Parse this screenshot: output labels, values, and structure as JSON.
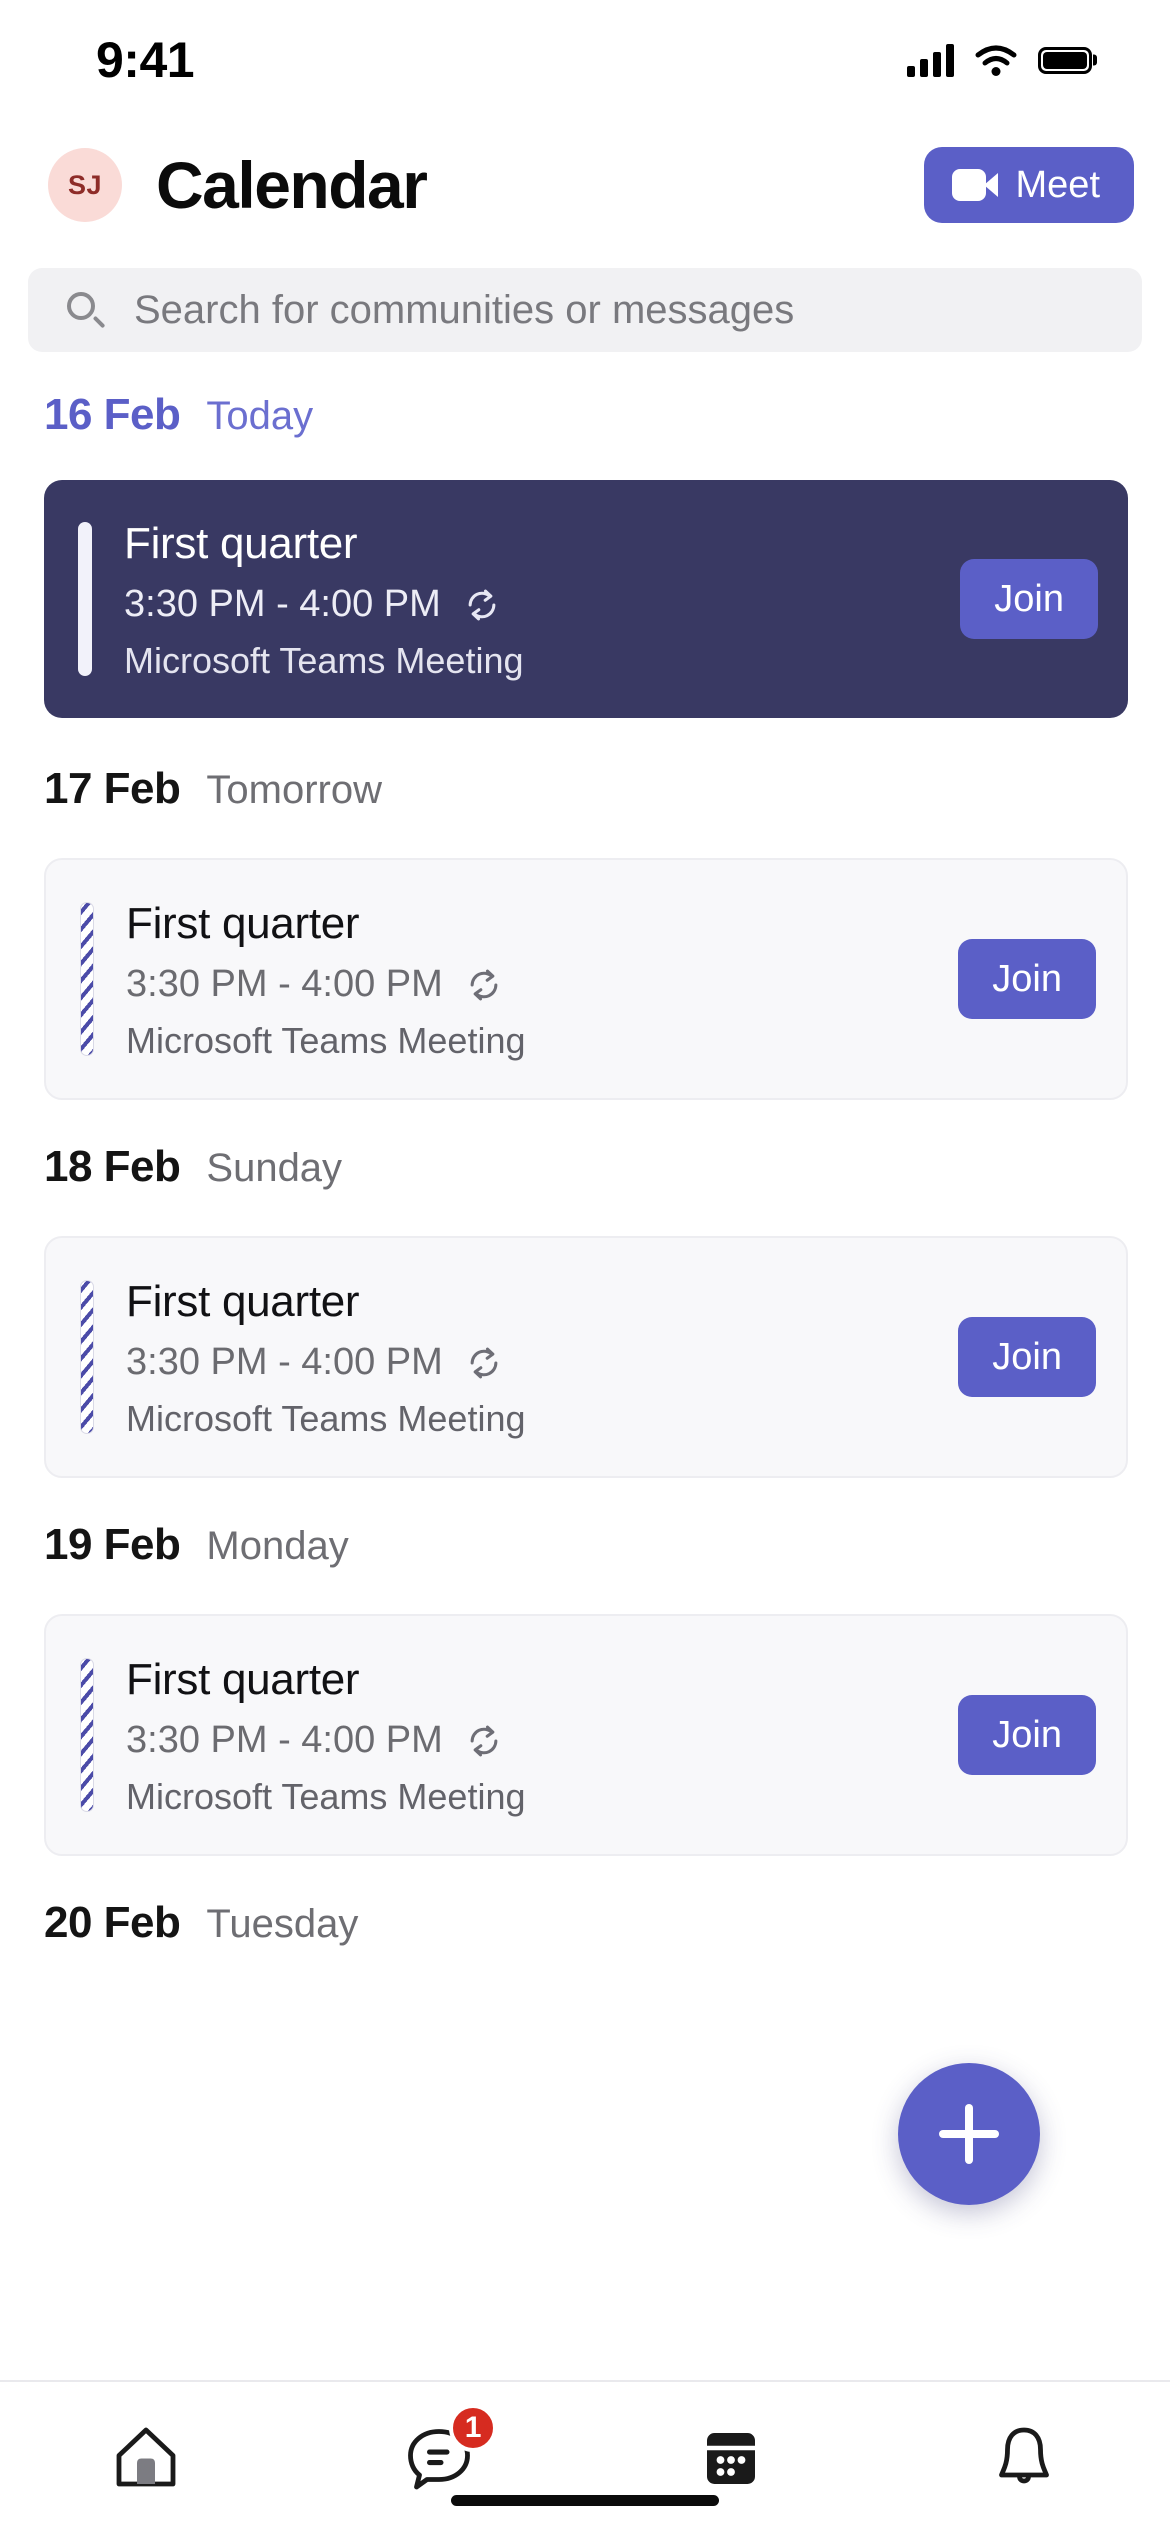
{
  "status_bar": {
    "time": "9:41",
    "signal_icon": "cellular-signal-icon",
    "wifi_icon": "wifi-icon",
    "battery_icon": "battery-icon"
  },
  "header": {
    "avatar_initials": "SJ",
    "avatar_bg": "#FADBD7",
    "avatar_fg": "#8E2C28",
    "title": "Calendar",
    "meet_label": "Meet",
    "meet_icon": "video-camera-icon",
    "accent_color": "#5B5FC7"
  },
  "search": {
    "placeholder": "Search for communities or messages",
    "icon": "search-icon",
    "value": ""
  },
  "days": [
    {
      "date": "16 Feb",
      "relative": "Today",
      "is_today": true,
      "events": [
        {
          "title": "First quarter",
          "time": "3:30 PM - 4:00 PM",
          "subtitle": "Microsoft Teams Meeting",
          "recurring": true,
          "recurring_icon": "recurring-icon",
          "join_label": "Join",
          "highlight": true,
          "accent_style": "solid"
        }
      ]
    },
    {
      "date": "17 Feb",
      "relative": "Tomorrow",
      "is_today": false,
      "events": [
        {
          "title": "First quarter",
          "time": "3:30 PM - 4:00 PM",
          "subtitle": "Microsoft Teams Meeting",
          "recurring": true,
          "recurring_icon": "recurring-icon",
          "join_label": "Join",
          "highlight": false,
          "accent_style": "striped"
        }
      ]
    },
    {
      "date": "18 Feb",
      "relative": "Sunday",
      "is_today": false,
      "events": [
        {
          "title": "First quarter",
          "time": "3:30 PM - 4:00 PM",
          "subtitle": "Microsoft Teams Meeting",
          "recurring": true,
          "recurring_icon": "recurring-icon",
          "join_label": "Join",
          "highlight": false,
          "accent_style": "striped"
        }
      ]
    },
    {
      "date": "19 Feb",
      "relative": "Monday",
      "is_today": false,
      "events": [
        {
          "title": "First quarter",
          "time": "3:30 PM - 4:00 PM",
          "subtitle": "Microsoft Teams Meeting",
          "recurring": true,
          "recurring_icon": "recurring-icon",
          "join_label": "Join",
          "highlight": false,
          "accent_style": "striped"
        }
      ]
    },
    {
      "date": "20 Feb",
      "relative": "Tuesday",
      "is_today": false,
      "events": []
    }
  ],
  "fab": {
    "icon": "plus-icon",
    "color": "#5B5FC7"
  },
  "tab_bar": {
    "items": [
      {
        "icon": "home-icon",
        "active": false,
        "badge": null
      },
      {
        "icon": "chat-icon",
        "active": false,
        "badge": "1"
      },
      {
        "icon": "calendar-icon",
        "active": true,
        "badge": null
      },
      {
        "icon": "bell-icon",
        "active": false,
        "badge": null
      }
    ],
    "badge_color": "#D62B20"
  }
}
